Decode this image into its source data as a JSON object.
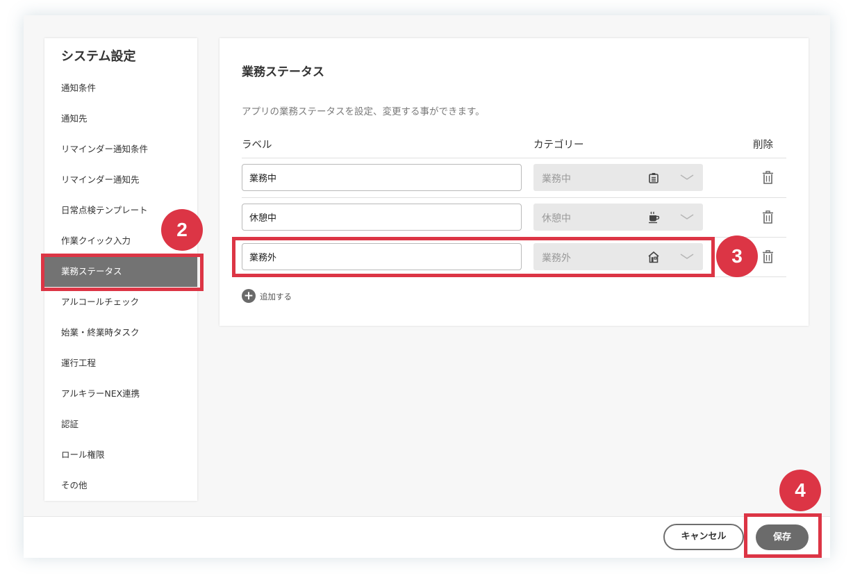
{
  "sidebar": {
    "title": "システム設定",
    "items": [
      {
        "label": "通知条件"
      },
      {
        "label": "通知先"
      },
      {
        "label": "リマインダー通知条件"
      },
      {
        "label": "リマインダー通知先"
      },
      {
        "label": "日常点検テンプレート"
      },
      {
        "label": "作業クイック入力"
      },
      {
        "label": "業務ステータス",
        "active": true
      },
      {
        "label": "アルコールチェック"
      },
      {
        "label": "始業・終業時タスク"
      },
      {
        "label": "運行工程"
      },
      {
        "label": "アルキラーNEX連携"
      },
      {
        "label": "認証"
      },
      {
        "label": "ロール権限"
      },
      {
        "label": "その他"
      }
    ]
  },
  "panel": {
    "title": "業務ステータス",
    "description": "アプリの業務ステータスを設定、変更する事ができます。",
    "columns": {
      "label": "ラベル",
      "category": "カテゴリー",
      "delete": "削除"
    },
    "rows": [
      {
        "label": "業務中",
        "category": "業務中",
        "icon": "clipboard-icon"
      },
      {
        "label": "休憩中",
        "category": "休憩中",
        "icon": "coffee-cup-icon"
      },
      {
        "label": "業務外",
        "category": "業務外",
        "icon": "house-icon"
      }
    ],
    "add_label": "追加する"
  },
  "footer": {
    "cancel_label": "キャンセル",
    "save_label": "保存"
  },
  "annotations": {
    "badge_2": "2",
    "badge_3": "3",
    "badge_4": "4"
  },
  "colors": {
    "accent": "#dc3545",
    "active_item": "#737373",
    "button": "#6b6b6b"
  }
}
